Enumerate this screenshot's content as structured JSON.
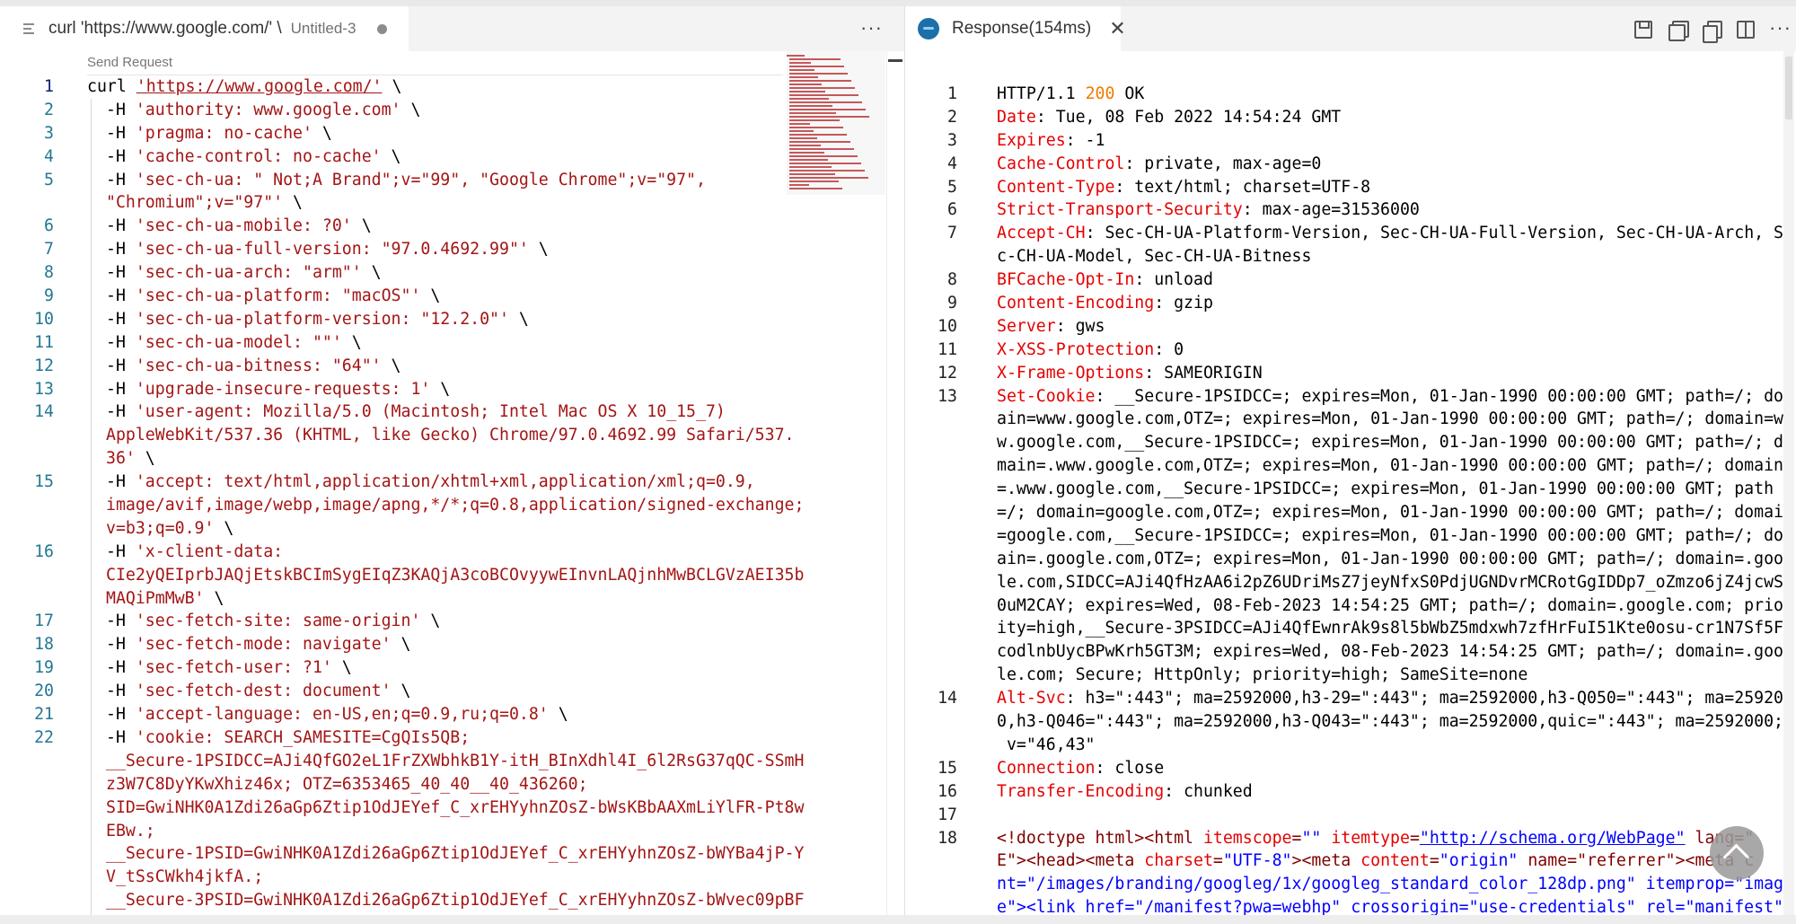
{
  "left_tab": {
    "title": "curl 'https://www.google.com/' \\",
    "description": "Untitled-3"
  },
  "left_editor": {
    "codelens": "Send Request",
    "line_numbers": [
      "1",
      "2",
      "3",
      "4",
      "5",
      "6",
      "7",
      "8",
      "9",
      "10",
      "11",
      "12",
      "13",
      "14",
      "15",
      "16",
      "17",
      "18",
      "19",
      "20",
      "21",
      "22"
    ],
    "lines": [
      [
        "curl ",
        "'https://www.google.com/'",
        " \\"
      ],
      [
        "-H ",
        "'authority: www.google.com'",
        " \\"
      ],
      [
        "-H ",
        "'pragma: no-cache'",
        " \\"
      ],
      [
        "-H ",
        "'cache-control: no-cache'",
        " \\"
      ],
      [
        "-H ",
        "'sec-ch-ua: \" Not;A Brand\";v=\"99\", \"Google Chrome\";v=\"97\",",
        ""
      ],
      [
        "",
        "\"Chromium\";v=\"97\"'",
        " \\"
      ],
      [
        "-H ",
        "'sec-ch-ua-mobile: ?0'",
        " \\"
      ],
      [
        "-H ",
        "'sec-ch-ua-full-version: \"97.0.4692.99\"'",
        " \\"
      ],
      [
        "-H ",
        "'sec-ch-ua-arch: \"arm\"'",
        " \\"
      ],
      [
        "-H ",
        "'sec-ch-ua-platform: \"macOS\"'",
        " \\"
      ],
      [
        "-H ",
        "'sec-ch-ua-platform-version: \"12.2.0\"'",
        " \\"
      ],
      [
        "-H ",
        "'sec-ch-ua-model: \"\"'",
        " \\"
      ],
      [
        "-H ",
        "'sec-ch-ua-bitness: \"64\"'",
        " \\"
      ],
      [
        "-H ",
        "'upgrade-insecure-requests: 1'",
        " \\"
      ],
      [
        "-H ",
        "'user-agent: Mozilla/5.0 (Macintosh; Intel Mac OS X 10_15_7)",
        ""
      ],
      [
        "",
        "AppleWebKit/537.36 (KHTML, like Gecko) Chrome/97.0.4692.99 Safari/537.",
        ""
      ],
      [
        "",
        "36'",
        " \\"
      ],
      [
        "-H ",
        "'accept: text/html,application/xhtml+xml,application/xml;q=0.9,",
        ""
      ],
      [
        "",
        "image/avif,image/webp,image/apng,*/*;q=0.8,application/signed-exchange;",
        ""
      ],
      [
        "",
        "v=b3;q=0.9'",
        " \\"
      ],
      [
        "-H ",
        "'x-client-data:",
        ""
      ],
      [
        "",
        "CIe2yQEIprbJAQjEtskBCImSygEIqZ3KAQjA3coBCOvyywEInvnLAQjnhMwBCLGVzAEI35b",
        ""
      ],
      [
        "",
        "MAQiPmMwB'",
        " \\"
      ],
      [
        "-H ",
        "'sec-fetch-site: same-origin'",
        " \\"
      ],
      [
        "-H ",
        "'sec-fetch-mode: navigate'",
        " \\"
      ],
      [
        "-H ",
        "'sec-fetch-user: ?1'",
        " \\"
      ],
      [
        "-H ",
        "'sec-fetch-dest: document'",
        " \\"
      ],
      [
        "-H ",
        "'accept-language: en-US,en;q=0.9,ru;q=0.8'",
        " \\"
      ],
      [
        "-H ",
        "'cookie: SEARCH_SAMESITE=CgQIs5QB;",
        ""
      ],
      [
        "",
        "__Secure-1PSIDCC=AJi4QfGO2eL1FrZXWbhkB1Y-itH_BInXdhl4I_6l2RsG37qQC-SSmH",
        ""
      ],
      [
        "",
        "z3W7C8DyYKwXhiz46x; OTZ=6353465_40_40__40_436260;",
        ""
      ],
      [
        "",
        "SID=GwiNHK0A1Zdi26aGp6Ztip1OdJEYef_C_xrEHYyhnZOsZ-bWsKBbAAXmLiYlFR-Pt8w",
        ""
      ],
      [
        "",
        "EBw.;",
        ""
      ],
      [
        "",
        "__Secure-1PSID=GwiNHK0A1Zdi26aGp6Ztip1OdJEYef_C_xrEHYyhnZOsZ-bWYBa4jP-Y",
        ""
      ],
      [
        "",
        "V_tSsCWkh4jkfA.;",
        ""
      ],
      [
        "",
        "__Secure-3PSID=GwiNHK0A1Zdi26aGp6Ztip1OdJEYef_C_xrEHYyhnZOsZ-bWvec09pBF",
        ""
      ]
    ]
  },
  "right_tab": {
    "title": "Response(154ms)"
  },
  "response": {
    "line_numbers": [
      "1",
      "2",
      "3",
      "4",
      "5",
      "6",
      "7",
      "8",
      "9",
      "10",
      "11",
      "12",
      "13",
      "14",
      "15",
      "16",
      "17",
      "18"
    ],
    "lines": [
      [
        "",
        "HTTP/1.1 ",
        "200",
        " OK"
      ],
      [
        "Date",
        ": Tue, 08 Feb 2022 14:54:24 GMT"
      ],
      [
        "Expires",
        ": -1"
      ],
      [
        "Cache-Control",
        ": private, max-age=0"
      ],
      [
        "Content-Type",
        ": text/html; charset=UTF-8"
      ],
      [
        "Strict-Transport-Security",
        ": max-age=31536000"
      ],
      [
        "Accept-CH",
        ": Sec-CH-UA-Platform-Version, Sec-CH-UA-Full-Version, Sec-CH-UA-Arch, Se"
      ],
      [
        "",
        "c-CH-UA-Model, Sec-CH-UA-Bitness"
      ],
      [
        "BFCache-Opt-In",
        ": unload"
      ],
      [
        "Content-Encoding",
        ": gzip"
      ],
      [
        "Server",
        ": gws"
      ],
      [
        "X-XSS-Protection",
        ": 0"
      ],
      [
        "X-Frame-Options",
        ": SAMEORIGIN"
      ],
      [
        "Set-Cookie",
        ": __Secure-1PSIDCC=; expires=Mon, 01-Jan-1990 00:00:00 GMT; path=/; dom"
      ],
      [
        "",
        "ain=www.google.com,OTZ=; expires=Mon, 01-Jan-1990 00:00:00 GMT; path=/; domain=ww"
      ],
      [
        "",
        "w.google.com,__Secure-1PSIDCC=; expires=Mon, 01-Jan-1990 00:00:00 GMT; path=/; do"
      ],
      [
        "",
        "main=.www.google.com,OTZ=; expires=Mon, 01-Jan-1990 00:00:00 GMT; path=/; domain"
      ],
      [
        "",
        "=.www.google.com,__Secure-1PSIDCC=; expires=Mon, 01-Jan-1990 00:00:00 GMT; path"
      ],
      [
        "",
        "=/; domain=google.com,OTZ=; expires=Mon, 01-Jan-1990 00:00:00 GMT; path=/; domain"
      ],
      [
        "",
        "=google.com,__Secure-1PSIDCC=; expires=Mon, 01-Jan-1990 00:00:00 GMT; path=/; dom"
      ],
      [
        "",
        "ain=.google.com,OTZ=; expires=Mon, 01-Jan-1990 00:00:00 GMT; path=/; domain=.goog"
      ],
      [
        "",
        "le.com,SIDCC=AJi4QfHzAA6i2pZ6UDriMsZ7jeyNfxS0PdjUGNDvrMCRotGgIDDp7_oZmzo6jZ4jcwS"
      ],
      [
        "",
        "0uM2CAY; expires=Wed, 08-Feb-2023 14:54:25 GMT; path=/; domain=.google.com; prior"
      ],
      [
        "",
        "ity=high,__Secure-3PSIDCC=AJi4QfEwnrAk9s8l5bWbZ5mdxwh7zfHrFuI51Kte0osu-cr1N7Sf5FK"
      ],
      [
        "",
        "codlnbUycBPwKrh5GT3M; expires=Wed, 08-Feb-2023 14:54:25 GMT; path=/; domain=.goog"
      ],
      [
        "",
        "le.com; Secure; HttpOnly; priority=high; SameSite=none"
      ],
      [
        "Alt-Svc",
        ": h3=\":443\"; ma=2592000,h3-29=\":443\"; ma=2592000,h3-Q050=\":443\"; ma=259200"
      ],
      [
        "",
        "0,h3-Q046=\":443\"; ma=2592000,h3-Q043=\":443\"; ma=2592000,quic=\":443\"; ma=2592000;"
      ],
      [
        "",
        " v=\"46,43\""
      ],
      [
        "Connection",
        ": close"
      ],
      [
        "Transfer-Encoding",
        ": chunked"
      ],
      [
        "",
        ""
      ]
    ],
    "html_lines": [
      [
        "<!doctype html><html ",
        "itemscope",
        "=",
        "\"\"",
        " ",
        "itemtype",
        "=",
        "\"http://schema.org/WebPage\"",
        " lang=\""
      ],
      [
        "E\"><head><meta ",
        "charset",
        "=",
        "\"UTF-8\"",
        "><meta ",
        "content",
        "=",
        "\"origin\"",
        " name=\"referrer\"><meta c"
      ],
      [
        "nt=\"/images/branding/googleg/1x/googleg_standard_color_128dp.png\" itemprop=\"imag"
      ],
      [
        "e\"><link href=\"/manifest?pwa=webhp\" crossorigin=\"use-credentials\" rel=\"manifest\">"
      ]
    ]
  }
}
